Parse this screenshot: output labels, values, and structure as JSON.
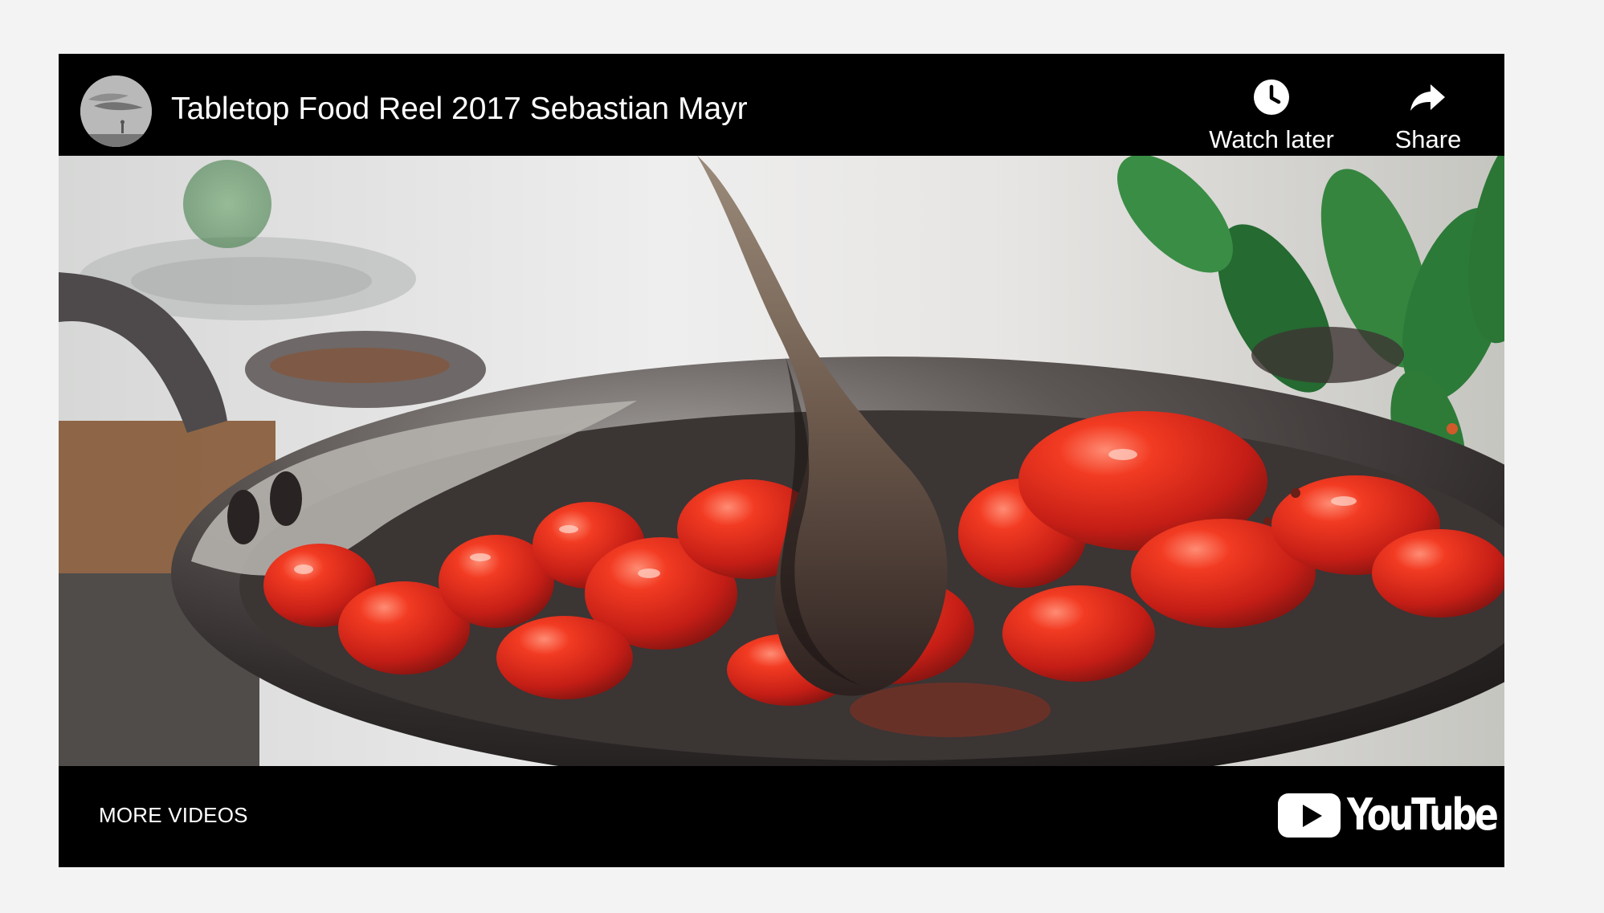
{
  "player": {
    "title": "Tabletop Food Reel 2017 Sebastian Mayr",
    "actions": {
      "watch_later": "Watch later",
      "share": "Share"
    },
    "more_videos": "MORE VIDEOS",
    "brand": "YouTube"
  },
  "colors": {
    "player_background": "#000000",
    "page_background": "#f3f3f4",
    "text": "#ffffff",
    "tomato_red": "#e13a1d",
    "pan_steel": "#4a4241",
    "basil_green": "#2f8a3f"
  },
  "icons": {
    "watch_later": "clock-icon",
    "share": "share-arrow-icon",
    "play": "play-icon"
  }
}
